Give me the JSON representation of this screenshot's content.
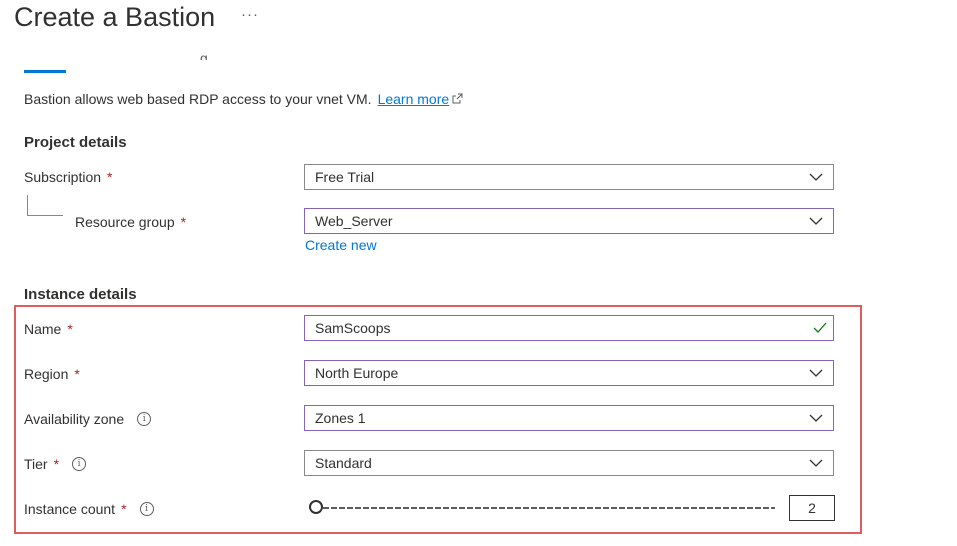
{
  "header": {
    "title": "Create a Bastion",
    "more_label": "···",
    "tab_fragment": "g"
  },
  "intro": {
    "text": "Bastion allows web based RDP access to your vnet VM.",
    "link": "Learn more"
  },
  "project": {
    "section_title": "Project details",
    "subscription": {
      "label": "Subscription",
      "value": "Free Trial"
    },
    "resource_group": {
      "label": "Resource group",
      "value": "Web_Server",
      "create_new": "Create new"
    }
  },
  "instance": {
    "section_title": "Instance details",
    "name": {
      "label": "Name",
      "value": "SamScoops"
    },
    "region": {
      "label": "Region",
      "value": "North Europe"
    },
    "zone": {
      "label": "Availability zone",
      "value": "Zones 1"
    },
    "tier": {
      "label": "Tier",
      "value": "Standard"
    },
    "count": {
      "label": "Instance count",
      "value": "2",
      "slider_fraction": 0.0
    }
  },
  "required_marker": "*",
  "colors": {
    "link": "#0078d4",
    "required": "#a4262c",
    "highlight": "#e15c5c",
    "valid_check": "#107c10"
  }
}
